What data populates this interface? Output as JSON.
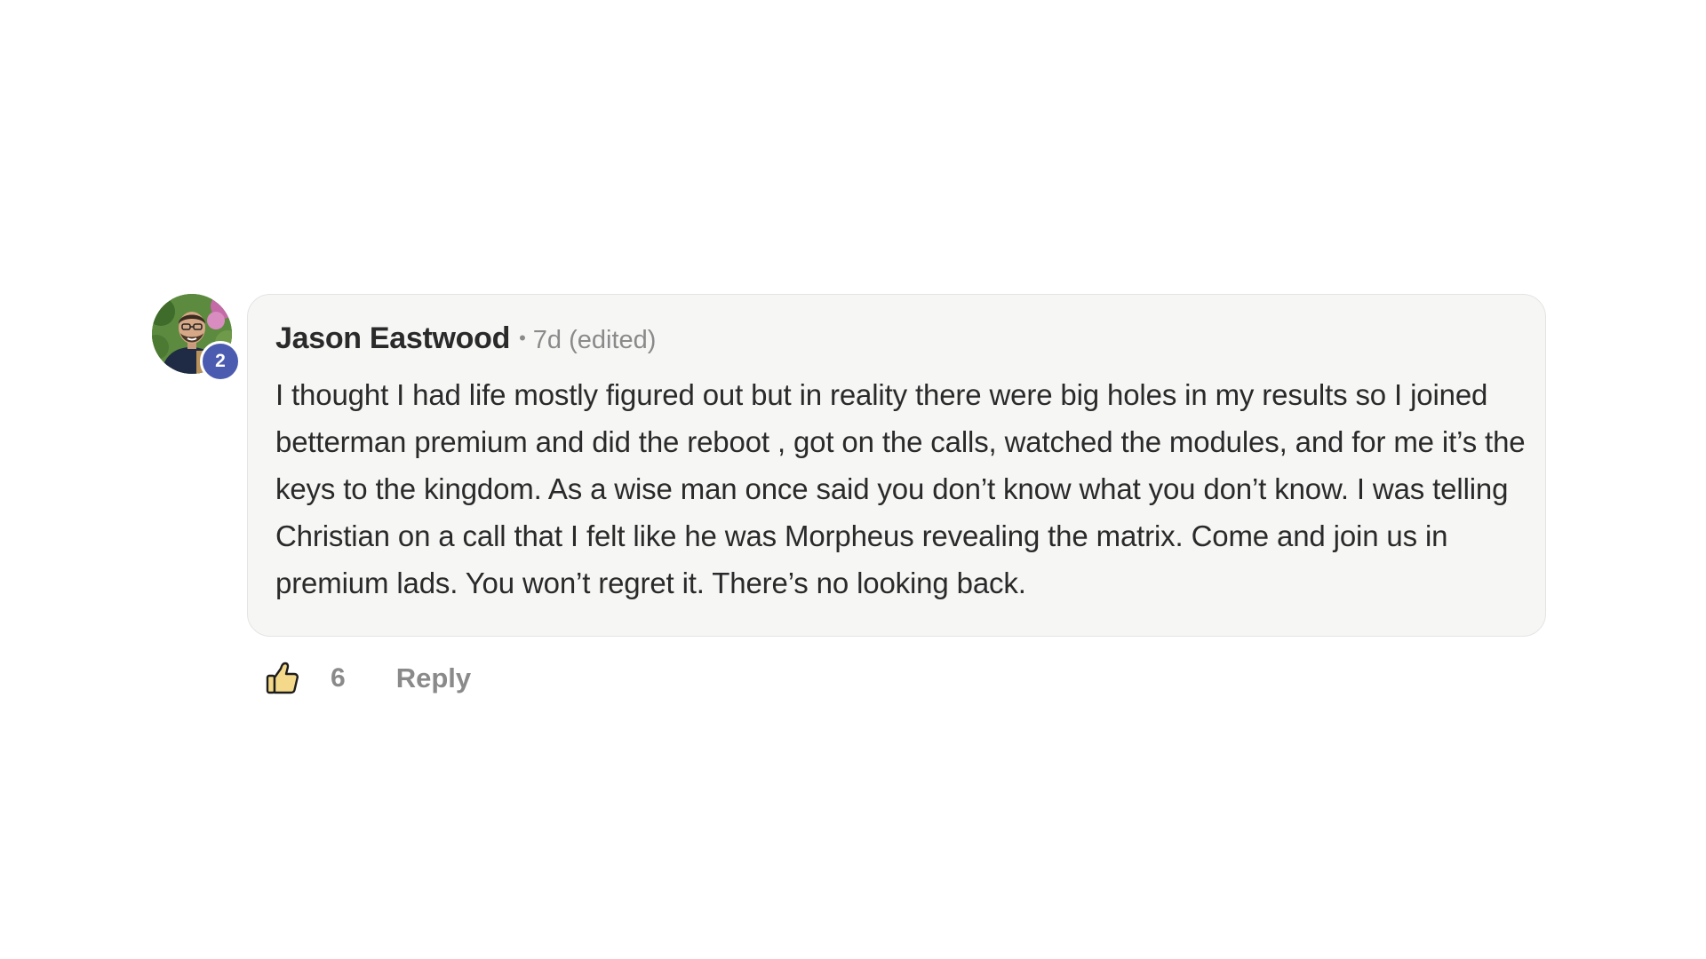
{
  "comment": {
    "author": "Jason Eastwood",
    "separator": "•",
    "meta": "7d (edited)",
    "level": "2",
    "body": "I thought I had life mostly figured out but in reality there were big holes in my results so I joined betterman premium and did the reboot , got on the calls, watched the modules, and for me it’s the keys to the kingdom. As a wise man once said you don’t know what you don’t know. I was telling Christian on a call that I felt like he was Morpheus revealing the matrix. Come and join us in premium lads. You won’t regret it. There’s no looking back.",
    "like_count": "6",
    "reply_label": "Reply",
    "like_icon": "thumbs-up-icon",
    "colors": {
      "badge": "#4b5bb0",
      "bubble": "#f6f6f5",
      "thumb_fill": "#f5d98a"
    }
  }
}
